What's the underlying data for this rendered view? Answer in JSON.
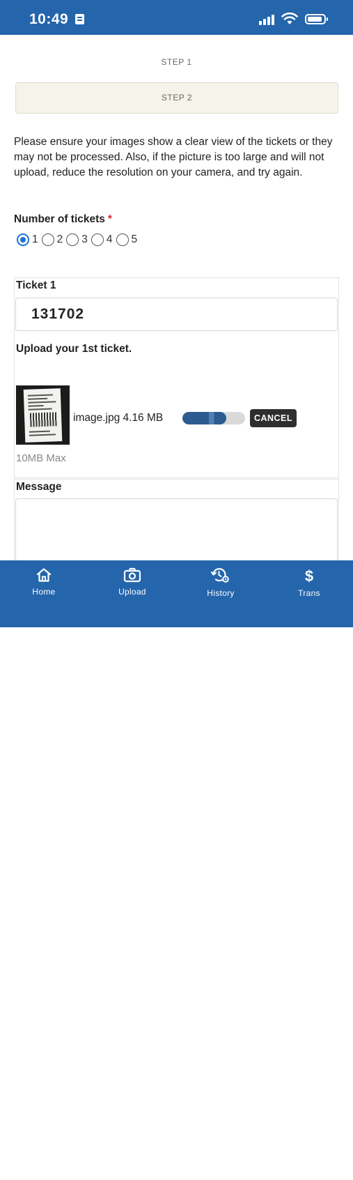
{
  "status_bar": {
    "time": "10:49"
  },
  "steps": {
    "step1": "STEP 1",
    "step2": "STEP 2"
  },
  "instructions": "Please ensure your images show a clear view of the tickets or they may not be processed. Also, if the picture is too large and will not upload, reduce the resolution on your camera, and try again.",
  "num_tickets": {
    "label": "Number of tickets",
    "required_marker": "*",
    "options": [
      "1",
      "2",
      "3",
      "4",
      "5"
    ],
    "selected": "1"
  },
  "ticket1": {
    "label": "Ticket 1",
    "value": "131702",
    "upload_label": "Upload your 1st ticket.",
    "file": {
      "name_size": "image.jpg 4.16 MB",
      "progress": 0.7,
      "cancel_label": "CANCEL"
    },
    "max_label": "10MB Max"
  },
  "message": {
    "label": "Message",
    "value": ""
  },
  "tabbar": {
    "items": [
      {
        "label": "Home",
        "icon": "home-icon"
      },
      {
        "label": "Upload",
        "icon": "camera-icon"
      },
      {
        "label": "History",
        "icon": "history-icon"
      },
      {
        "label": "Trans",
        "icon": "dollar-icon"
      }
    ]
  },
  "colors": {
    "brand": "#2465ab",
    "radio_selected": "#1e72d6",
    "required": "#d0312d"
  }
}
